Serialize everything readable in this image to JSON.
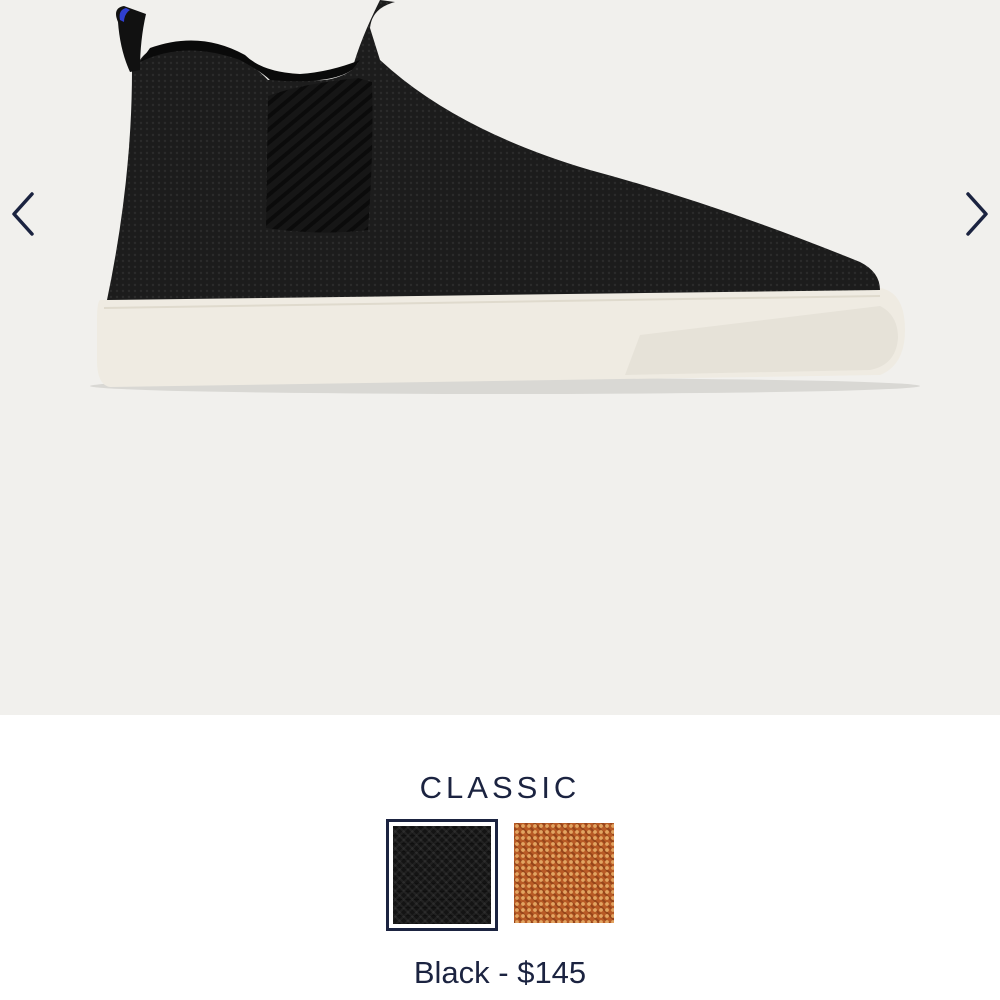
{
  "gallery": {
    "prev_icon": "chevron-left-icon",
    "next_icon": "chevron-right-icon",
    "image": "black-knit-chelsea-sneaker"
  },
  "product": {
    "collection": "CLASSIC",
    "swatches": [
      {
        "name": "Black",
        "color": "#141414",
        "selected": true
      },
      {
        "name": "Rust",
        "color": "#b85a25",
        "selected": false
      }
    ],
    "color_name": "Black",
    "separator": "-",
    "price": "$145"
  },
  "colors": {
    "hero_bg": "#f1f0ed",
    "text": "#1b2340",
    "heel_tab_accent": "#2f3fd1"
  }
}
